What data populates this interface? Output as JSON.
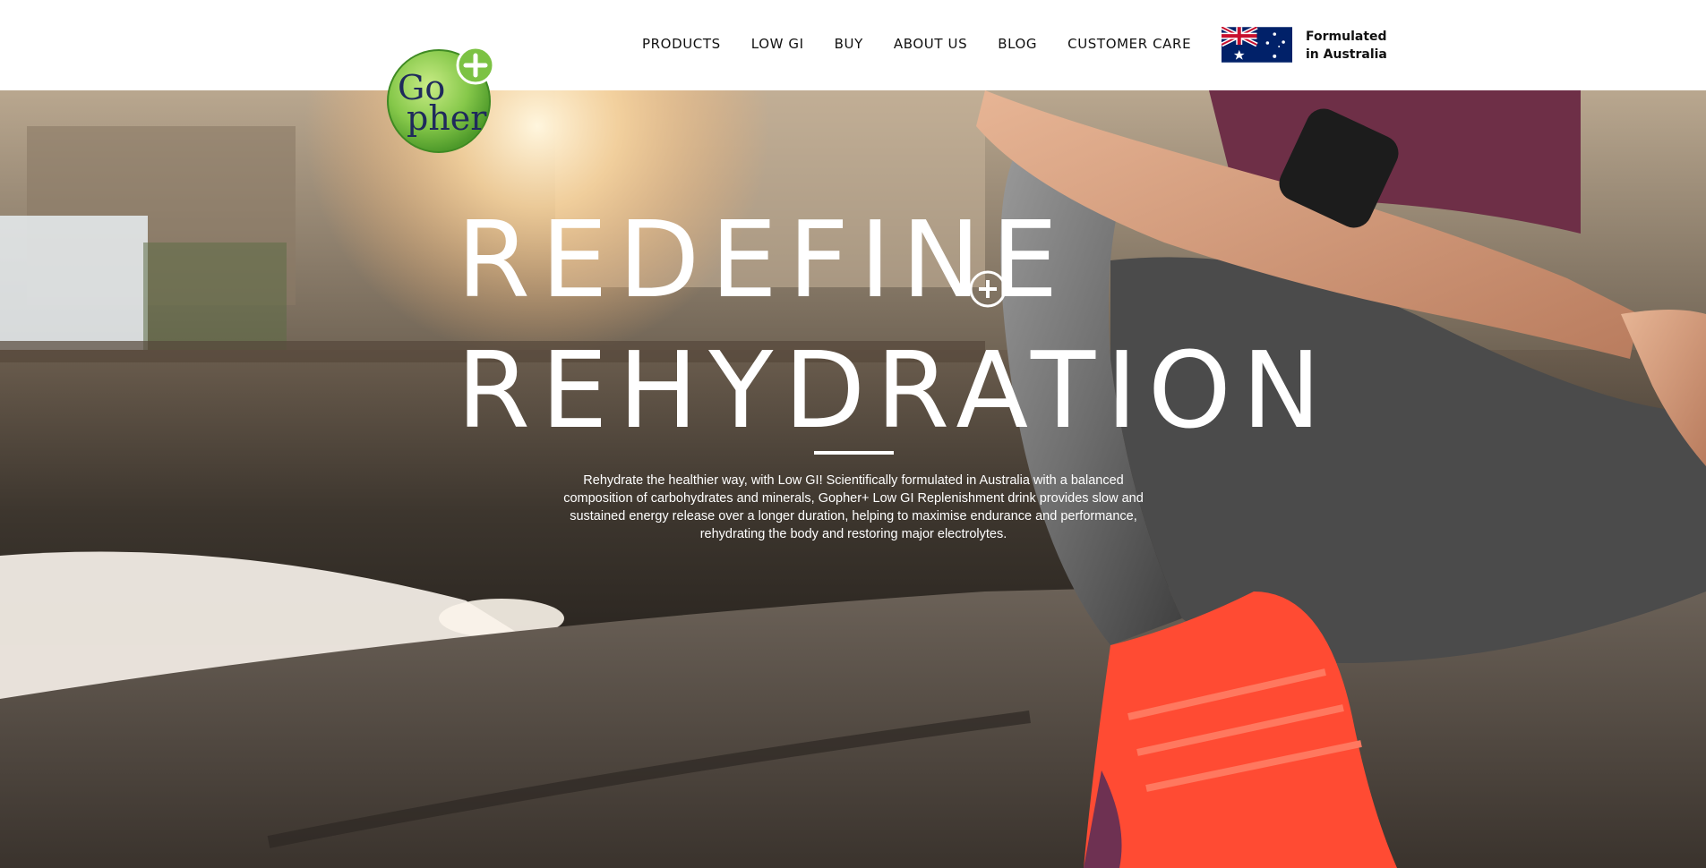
{
  "nav": {
    "items": [
      {
        "label": "PRODUCTS"
      },
      {
        "label": "LOW GI"
      },
      {
        "label": "BUY"
      },
      {
        "label": "ABOUT US"
      },
      {
        "label": "BLOG"
      },
      {
        "label": "CUSTOMER CARE"
      }
    ]
  },
  "logo": {
    "text_top": "Go",
    "text_bottom": "pher"
  },
  "origin": {
    "line1": "Formulated",
    "line2": "in Australia"
  },
  "hero": {
    "headline_line1": "REDEFINE",
    "headline_line2": "REHYDRATION",
    "description": "Rehydrate the healthier way, with Low GI! Scientifically formulated in Australia with a balanced composition of carbohydrates and minerals, Gopher+ Low GI Replenishment drink provides slow and sustained energy release over a longer duration, helping to maximise endurance and performance, rehydrating the body and restoring major electrolytes."
  },
  "colors": {
    "logo_green": "#7cc243",
    "logo_navy": "#1f2a5c",
    "shoe": "#ff4b33",
    "flag_blue": "#012169"
  }
}
